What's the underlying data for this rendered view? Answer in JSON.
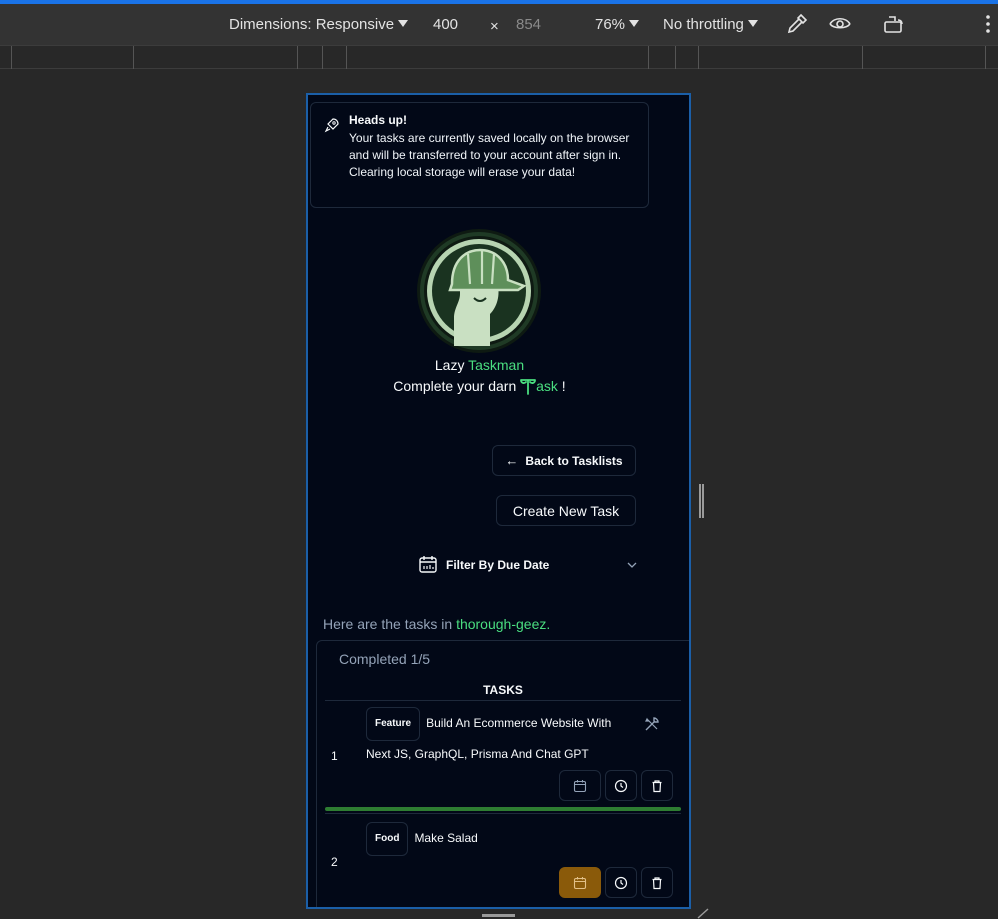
{
  "devtools": {
    "dimensions_label": "Dimensions: Responsive",
    "width": "400",
    "times": "×",
    "height": "854",
    "zoom": "76%",
    "throttling": "No throttling",
    "icons": [
      "eyedropper-icon",
      "eye-icon",
      "rotate-device-icon",
      "more-options-icon"
    ]
  },
  "alert": {
    "title": "Heads up!",
    "body": "Your tasks are currently saved locally on the browser and will be transferred to your account after sign in. Clearing local storage will erase your data!"
  },
  "brand": {
    "prefix": "Lazy ",
    "highlight": "Taskman"
  },
  "tagline": {
    "prefix": "Complete your darn ",
    "highlight": "ask",
    "suffix": " !"
  },
  "buttons": {
    "back": "Back to Tasklists",
    "back_arrow": "←",
    "create": "Create New Task"
  },
  "filter": {
    "label": "Filter By Due Date"
  },
  "intro": {
    "prefix": "Here are the tasks in ",
    "list_name": "thorough-geez."
  },
  "tasks_panel": {
    "completed": "Completed 1/5",
    "header": "TASKS",
    "rows": [
      {
        "index": "1",
        "tag": "Feature",
        "title": "Build An Ecommerce Website With Next JS, GraphQL, Prisma And Chat GPT",
        "progress": 1.0,
        "due_highlight": false
      },
      {
        "index": "2",
        "tag": "Food",
        "title": "Make Salad",
        "progress": 0,
        "due_highlight": true
      }
    ]
  },
  "colors": {
    "accent": "#4ade80",
    "background": "#020817",
    "border": "#1e293b",
    "progress": "#2e7d32",
    "due_warning": "#8a5a0a",
    "devtools_blue": "#1a73e8"
  }
}
